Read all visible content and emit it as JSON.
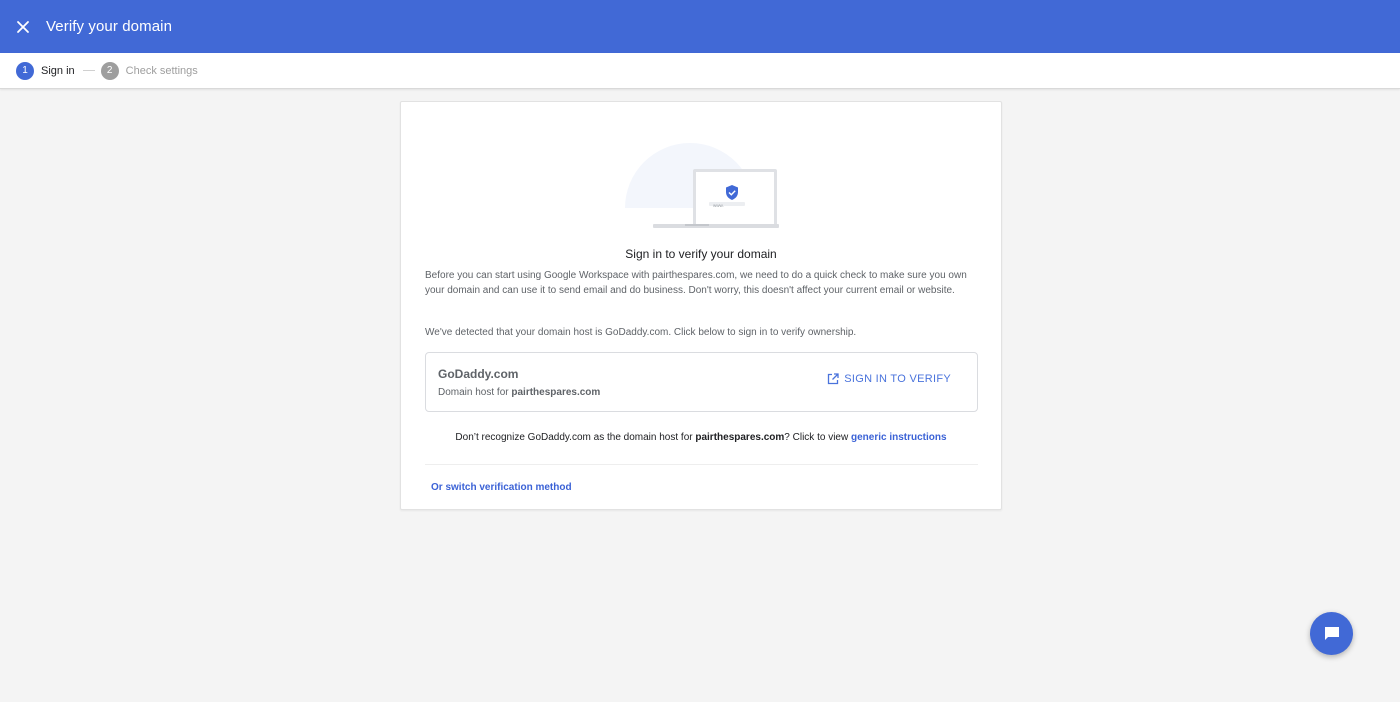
{
  "app": {
    "title": "Verify your domain",
    "colors": {
      "header": "#4169d6",
      "link": "#3b62d6",
      "background": "#f4f4f4"
    }
  },
  "header": {
    "close_icon": "close-icon"
  },
  "stepper": {
    "steps": [
      {
        "number": "1",
        "label": "Sign in",
        "active": true
      },
      {
        "number": "2",
        "label": "Check settings",
        "active": false
      }
    ]
  },
  "card": {
    "illustration": {
      "url_text": "www.",
      "icon": "shield-check-icon"
    },
    "heading": "Sign in to verify your domain",
    "description": "Before you can start using Google Workspace with pairthespares.com, we need to do a quick check to make sure you own your domain and can use it to send email and do business. Don't worry, this doesn't affect your current email or website.",
    "detected": "We've detected that your domain host is GoDaddy.com. Click below to sign in to verify ownership.",
    "host": {
      "name": "GoDaddy.com",
      "sub_prefix": "Domain host for ",
      "sub_domain": "pairthespares.com",
      "button_label": "SIGN IN TO VERIFY",
      "button_icon": "open-in-new-icon"
    },
    "unrecognized": {
      "prefix": "Don’t recognize GoDaddy.com as the domain host for ",
      "domain": "pairthespares.com",
      "middle": "? Click to view ",
      "link": "generic instructions"
    },
    "switch_label": "Or switch verification method"
  },
  "fab": {
    "icon": "chat-icon"
  }
}
